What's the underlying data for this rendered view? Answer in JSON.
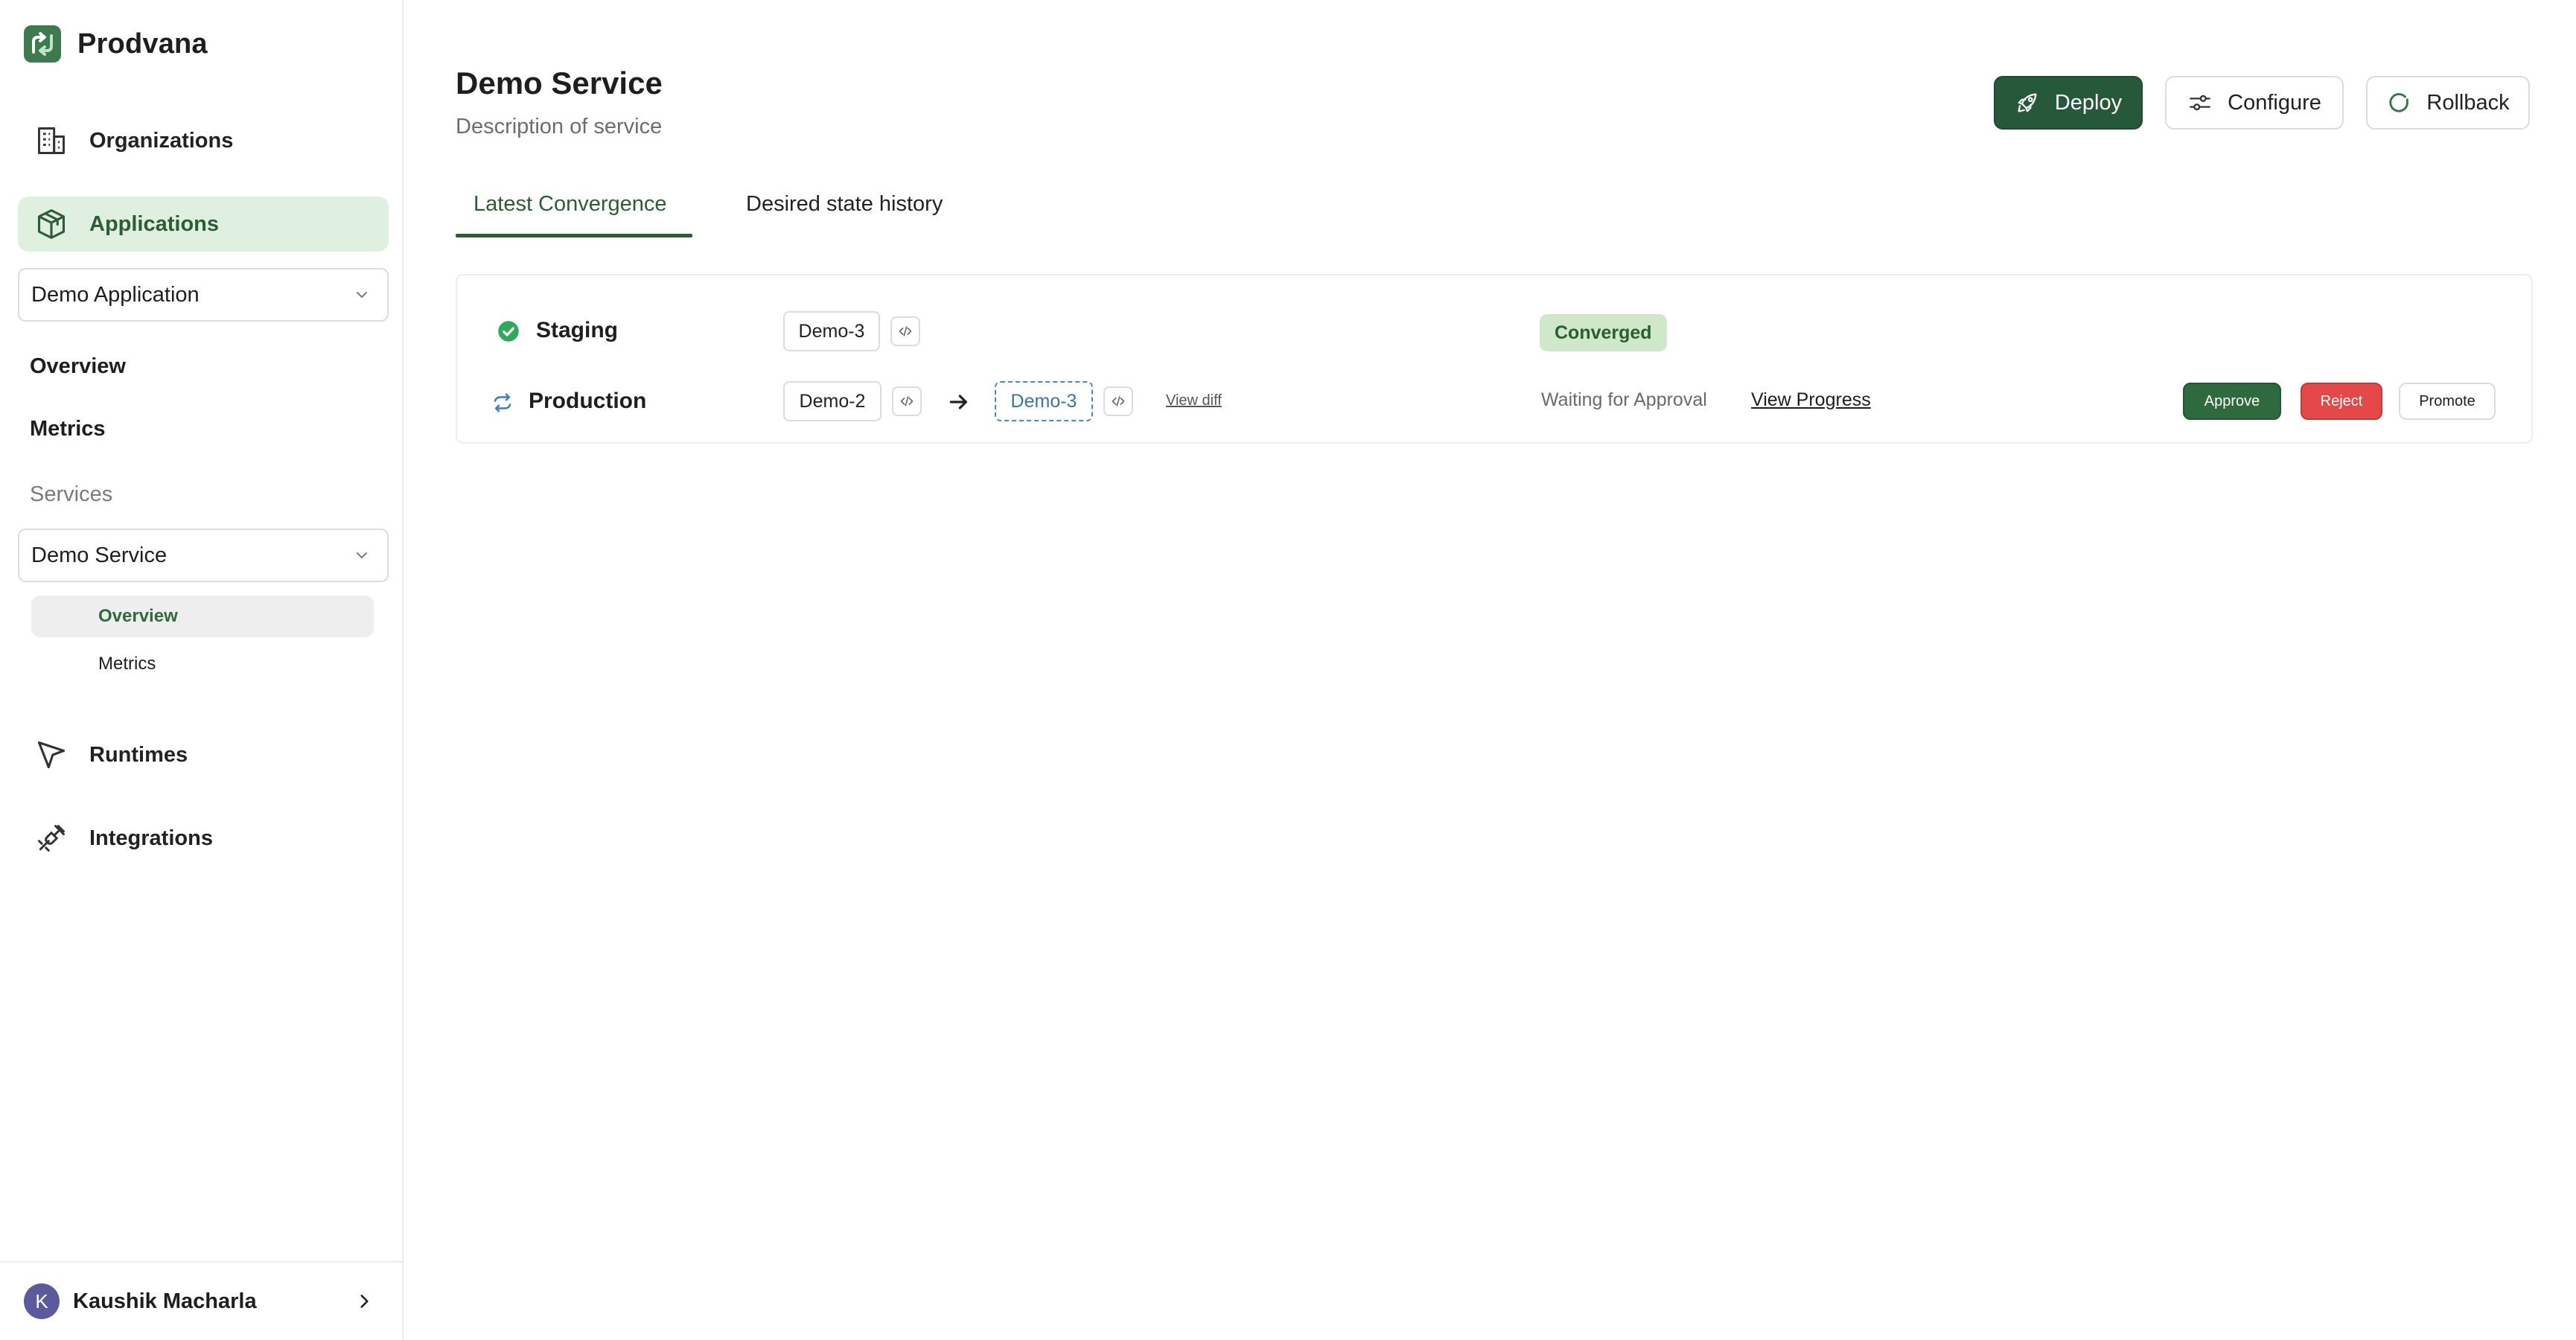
{
  "brand": {
    "name": "Prodvana",
    "logo_icon": "prodvana-logo-icon"
  },
  "sidebar": {
    "organizations_label": "Organizations",
    "applications_label": "Applications",
    "application_select": "Demo Application",
    "app_links": {
      "overview": "Overview",
      "metrics": "Metrics"
    },
    "services_heading": "Services",
    "service_select": "Demo Service",
    "service_links": {
      "overview": "Overview",
      "metrics": "Metrics"
    },
    "runtimes_label": "Runtimes",
    "integrations_label": "Integrations",
    "user": {
      "initial": "K",
      "name": "Kaushik Macharla"
    }
  },
  "header": {
    "title": "Demo Service",
    "description": "Description of service",
    "deploy_label": "Deploy",
    "configure_label": "Configure",
    "rollback_label": "Rollback"
  },
  "tabs": {
    "latest": "Latest Convergence",
    "history": "Desired state history"
  },
  "environments": [
    {
      "name": "Staging",
      "status_icon": "check-circle-icon",
      "current_version": "Demo-3",
      "status": "Converged"
    },
    {
      "name": "Production",
      "status_icon": "sync-icon",
      "current_version": "Demo-2",
      "target_version": "Demo-3",
      "view_diff": "View diff",
      "status": "Waiting for Approval",
      "view_progress": "View Progress",
      "approve_label": "Approve",
      "reject_label": "Reject",
      "promote_label": "Promote"
    }
  ],
  "colors": {
    "accent": "#26583a",
    "active_bg": "#e0f0e0",
    "converged_bg": "#cfe8c9",
    "reject": "#e44848"
  }
}
